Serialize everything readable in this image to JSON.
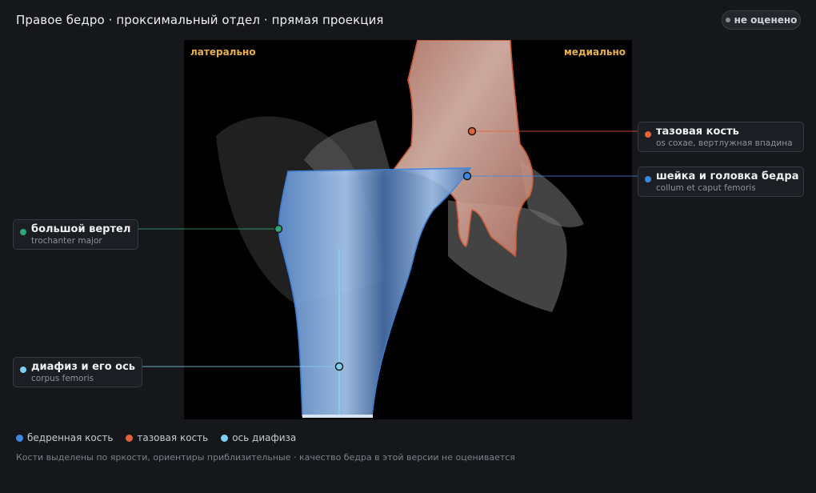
{
  "header": {
    "title": "Правое бедро · проксимальный отдел · прямая проекция",
    "status_badge": "не оценено"
  },
  "viewer": {
    "side_left": "латерально",
    "side_right": "медиально"
  },
  "landmarks": [
    {
      "name": "тазовая кость",
      "latin": "os coxae, вертлужная впадина",
      "color": "#e0613a"
    },
    {
      "name": "шейка и головка бедра",
      "latin": "collum et caput femoris",
      "color": "#3f86e0"
    },
    {
      "name": "большой вертел",
      "latin": "trochanter major",
      "color": "#2fa87a"
    },
    {
      "name": "диафиз и его ось",
      "latin": "corpus femoris",
      "color": "#7fd0f0"
    }
  ],
  "legend": [
    {
      "label": "бедренная кость",
      "color": "#3f86e0"
    },
    {
      "label": "тазовая кость",
      "color": "#e0613a"
    },
    {
      "label": "ось диафиза",
      "color": "#7fd0f0"
    }
  ],
  "footnote": "Кости выделены по яркости, ориентиры приблизительные · качество бедра в этой версии не оценивается"
}
